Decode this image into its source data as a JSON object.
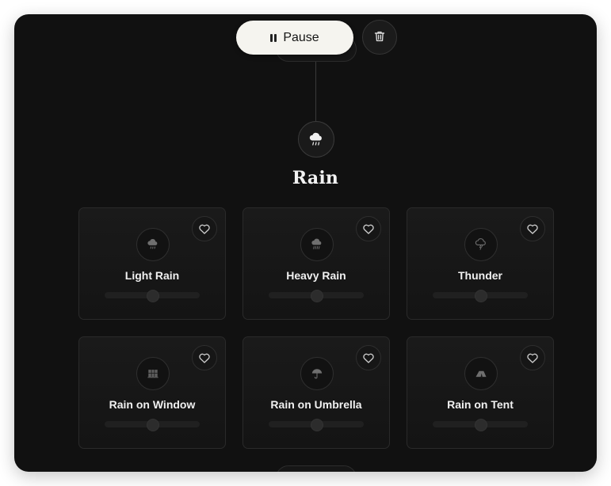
{
  "toolbar": {
    "pause_label": "Pause",
    "trash_icon": "trash-icon"
  },
  "category": {
    "title": "Rain",
    "icon": "rain-cloud-icon"
  },
  "sounds": [
    {
      "label": "Light Rain",
      "icon": "light-rain-icon",
      "volume": 0.5,
      "favorite": false
    },
    {
      "label": "Heavy Rain",
      "icon": "heavy-rain-icon",
      "volume": 0.5,
      "favorite": false
    },
    {
      "label": "Thunder",
      "icon": "thunder-cloud-icon",
      "volume": 0.5,
      "favorite": false
    },
    {
      "label": "Rain on Window",
      "icon": "window-icon",
      "volume": 0.5,
      "favorite": false
    },
    {
      "label": "Rain on Umbrella",
      "icon": "umbrella-icon",
      "volume": 0.5,
      "favorite": false
    },
    {
      "label": "Rain on Tent",
      "icon": "tent-icon",
      "volume": 0.5,
      "favorite": false
    }
  ],
  "colors": {
    "background": "#111111",
    "pause_button": "#f5f4ef",
    "card_border": "#2a2a2a"
  }
}
